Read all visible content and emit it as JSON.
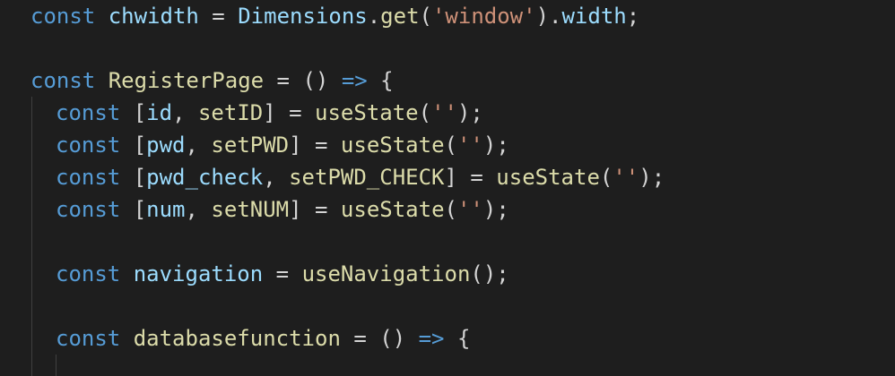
{
  "editor": {
    "language": "javascript",
    "theme_colors": {
      "background": "#1e1e1e",
      "keyword": "#569cd6",
      "variable": "#9cdcfe",
      "function": "#dcdcaa",
      "string": "#ce9178",
      "type": "#4ec9b0",
      "punctuation": "#d4d4d4"
    },
    "lines": [
      {
        "tokens": [
          {
            "t": "const",
            "k": "kw"
          },
          {
            "t": " ",
            "k": "pn"
          },
          {
            "t": "chwidth",
            "k": "var"
          },
          {
            "t": " = ",
            "k": "pn"
          },
          {
            "t": "Dimensions",
            "k": "var"
          },
          {
            "t": ".",
            "k": "pn"
          },
          {
            "t": "get",
            "k": "fn"
          },
          {
            "t": "(",
            "k": "pn"
          },
          {
            "t": "'window'",
            "k": "str"
          },
          {
            "t": ").",
            "k": "pn"
          },
          {
            "t": "width",
            "k": "var"
          },
          {
            "t": ";",
            "k": "pn"
          }
        ]
      },
      {
        "tokens": [
          {
            "t": "const",
            "k": "kw"
          },
          {
            "t": " ",
            "k": "pn"
          },
          {
            "t": "RegisterPage",
            "k": "fn"
          },
          {
            "t": " = ",
            "k": "pn"
          },
          {
            "t": "()",
            "k": "pn"
          },
          {
            "t": " ",
            "k": "pn"
          },
          {
            "t": "=>",
            "k": "kw"
          },
          {
            "t": " ",
            "k": "pn"
          },
          {
            "t": "{",
            "k": "pn"
          }
        ]
      },
      {
        "tokens": [
          {
            "t": "const",
            "k": "kw"
          },
          {
            "t": " [",
            "k": "pn"
          },
          {
            "t": "id",
            "k": "var"
          },
          {
            "t": ", ",
            "k": "pn"
          },
          {
            "t": "setID",
            "k": "fn"
          },
          {
            "t": "] = ",
            "k": "pn"
          },
          {
            "t": "useState",
            "k": "fn"
          },
          {
            "t": "(",
            "k": "pn"
          },
          {
            "t": "''",
            "k": "str"
          },
          {
            "t": ");",
            "k": "pn"
          }
        ]
      },
      {
        "tokens": [
          {
            "t": "const",
            "k": "kw"
          },
          {
            "t": " [",
            "k": "pn"
          },
          {
            "t": "pwd",
            "k": "var"
          },
          {
            "t": ", ",
            "k": "pn"
          },
          {
            "t": "setPWD",
            "k": "fn"
          },
          {
            "t": "] = ",
            "k": "pn"
          },
          {
            "t": "useState",
            "k": "fn"
          },
          {
            "t": "(",
            "k": "pn"
          },
          {
            "t": "''",
            "k": "str"
          },
          {
            "t": ");",
            "k": "pn"
          }
        ]
      },
      {
        "tokens": [
          {
            "t": "const",
            "k": "kw"
          },
          {
            "t": " [",
            "k": "pn"
          },
          {
            "t": "pwd_check",
            "k": "var"
          },
          {
            "t": ", ",
            "k": "pn"
          },
          {
            "t": "setPWD_CHECK",
            "k": "fn"
          },
          {
            "t": "] = ",
            "k": "pn"
          },
          {
            "t": "useState",
            "k": "fn"
          },
          {
            "t": "(",
            "k": "pn"
          },
          {
            "t": "''",
            "k": "str"
          },
          {
            "t": ");",
            "k": "pn"
          }
        ]
      },
      {
        "tokens": [
          {
            "t": "const",
            "k": "kw"
          },
          {
            "t": " [",
            "k": "pn"
          },
          {
            "t": "num",
            "k": "var"
          },
          {
            "t": ", ",
            "k": "pn"
          },
          {
            "t": "setNUM",
            "k": "fn"
          },
          {
            "t": "] = ",
            "k": "pn"
          },
          {
            "t": "useState",
            "k": "fn"
          },
          {
            "t": "(",
            "k": "pn"
          },
          {
            "t": "''",
            "k": "str"
          },
          {
            "t": ");",
            "k": "pn"
          }
        ]
      },
      {
        "tokens": [
          {
            "t": "const",
            "k": "kw"
          },
          {
            "t": " ",
            "k": "pn"
          },
          {
            "t": "navigation",
            "k": "var"
          },
          {
            "t": " = ",
            "k": "pn"
          },
          {
            "t": "useNavigation",
            "k": "fn"
          },
          {
            "t": "();",
            "k": "pn"
          }
        ]
      },
      {
        "tokens": [
          {
            "t": "const",
            "k": "kw"
          },
          {
            "t": " ",
            "k": "pn"
          },
          {
            "t": "databasefunction",
            "k": "fn"
          },
          {
            "t": " = ",
            "k": "pn"
          },
          {
            "t": "()",
            "k": "pn"
          },
          {
            "t": " ",
            "k": "pn"
          },
          {
            "t": "=>",
            "k": "kw"
          },
          {
            "t": " ",
            "k": "pn"
          },
          {
            "t": "{",
            "k": "pn"
          }
        ]
      }
    ]
  }
}
